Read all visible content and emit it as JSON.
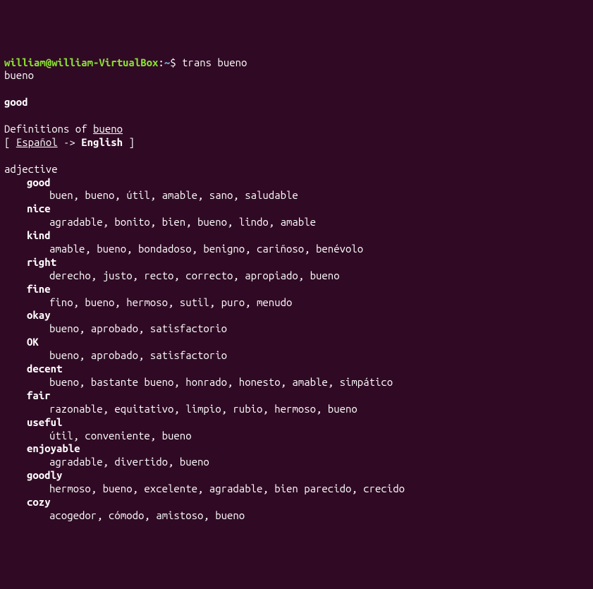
{
  "prompt": {
    "user_host": "william@william-VirtualBox",
    "colon": ":",
    "tilde": "~",
    "dollar": "$ ",
    "command": "trans bueno"
  },
  "echo": "bueno",
  "translation": "good",
  "definitions_label": "Definitions of ",
  "definitions_word": "bueno",
  "lang_bracket_open": "[ ",
  "lang_from": "Español",
  "lang_arrow": " -> ",
  "lang_to": "English",
  "lang_bracket_close": " ]",
  "pos": "adjective",
  "defs": [
    {
      "word": "good",
      "syns": "buen, bueno, útil, amable, sano, saludable"
    },
    {
      "word": "nice",
      "syns": "agradable, bonito, bien, bueno, lindo, amable"
    },
    {
      "word": "kind",
      "syns": "amable, bueno, bondadoso, benigno, cariñoso, benévolo"
    },
    {
      "word": "right",
      "syns": "derecho, justo, recto, correcto, apropiado, bueno"
    },
    {
      "word": "fine",
      "syns": "fino, bueno, hermoso, sutil, puro, menudo"
    },
    {
      "word": "okay",
      "syns": "bueno, aprobado, satisfactorio"
    },
    {
      "word": "OK",
      "syns": "bueno, aprobado, satisfactorio"
    },
    {
      "word": "decent",
      "syns": "bueno, bastante bueno, honrado, honesto, amable, simpático"
    },
    {
      "word": "fair",
      "syns": "razonable, equitativo, limpio, rubio, hermoso, bueno"
    },
    {
      "word": "useful",
      "syns": "útil, conveniente, bueno"
    },
    {
      "word": "enjoyable",
      "syns": "agradable, divertido, bueno"
    },
    {
      "word": "goodly",
      "syns": "hermoso, bueno, excelente, agradable, bien parecido, crecido"
    },
    {
      "word": "cozy",
      "syns": "acogedor, cómodo, amistoso, bueno"
    }
  ]
}
